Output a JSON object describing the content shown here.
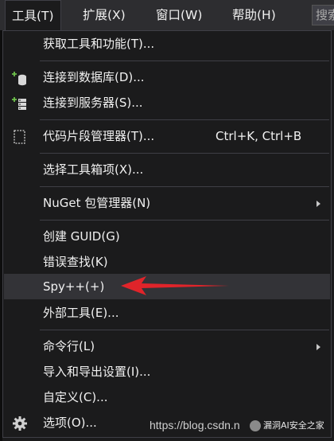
{
  "menubar": {
    "items": [
      {
        "label": "工具(T)",
        "active": true
      },
      {
        "label": "扩展(X)"
      },
      {
        "label": "窗口(W)"
      },
      {
        "label": "帮助(H)"
      }
    ],
    "search_text": "搜索"
  },
  "menu": {
    "items": [
      {
        "label": "获取工具和功能(T)..."
      },
      {
        "label": "连接到数据库(D)...",
        "icon": "database-connect-icon"
      },
      {
        "label": "连接到服务器(S)...",
        "icon": "server-connect-icon"
      },
      {
        "label": "代码片段管理器(T)...",
        "shortcut": "Ctrl+K, Ctrl+B",
        "icon": "snippet-icon"
      },
      {
        "label": "选择工具箱项(X)..."
      },
      {
        "label": "NuGet 包管理器(N)",
        "submenu": true
      },
      {
        "label": "创建 GUID(G)"
      },
      {
        "label": "错误查找(K)"
      },
      {
        "label": "Spy++(+)",
        "highlighted": true
      },
      {
        "label": "外部工具(E)..."
      },
      {
        "label": "命令行(L)",
        "submenu": true
      },
      {
        "label": "导入和导出设置(I)..."
      },
      {
        "label": "自定义(C)..."
      },
      {
        "label": "选项(O)...",
        "icon": "gear-icon"
      }
    ]
  },
  "watermark": {
    "url_text": "https://blog.csdn.n",
    "badge_text": "漏洞AI安全之家"
  },
  "colors": {
    "background": "#1b1b1c",
    "menubar": "#2d2d30",
    "highlight": "#333337",
    "annotation_arrow": "#e0242a"
  }
}
